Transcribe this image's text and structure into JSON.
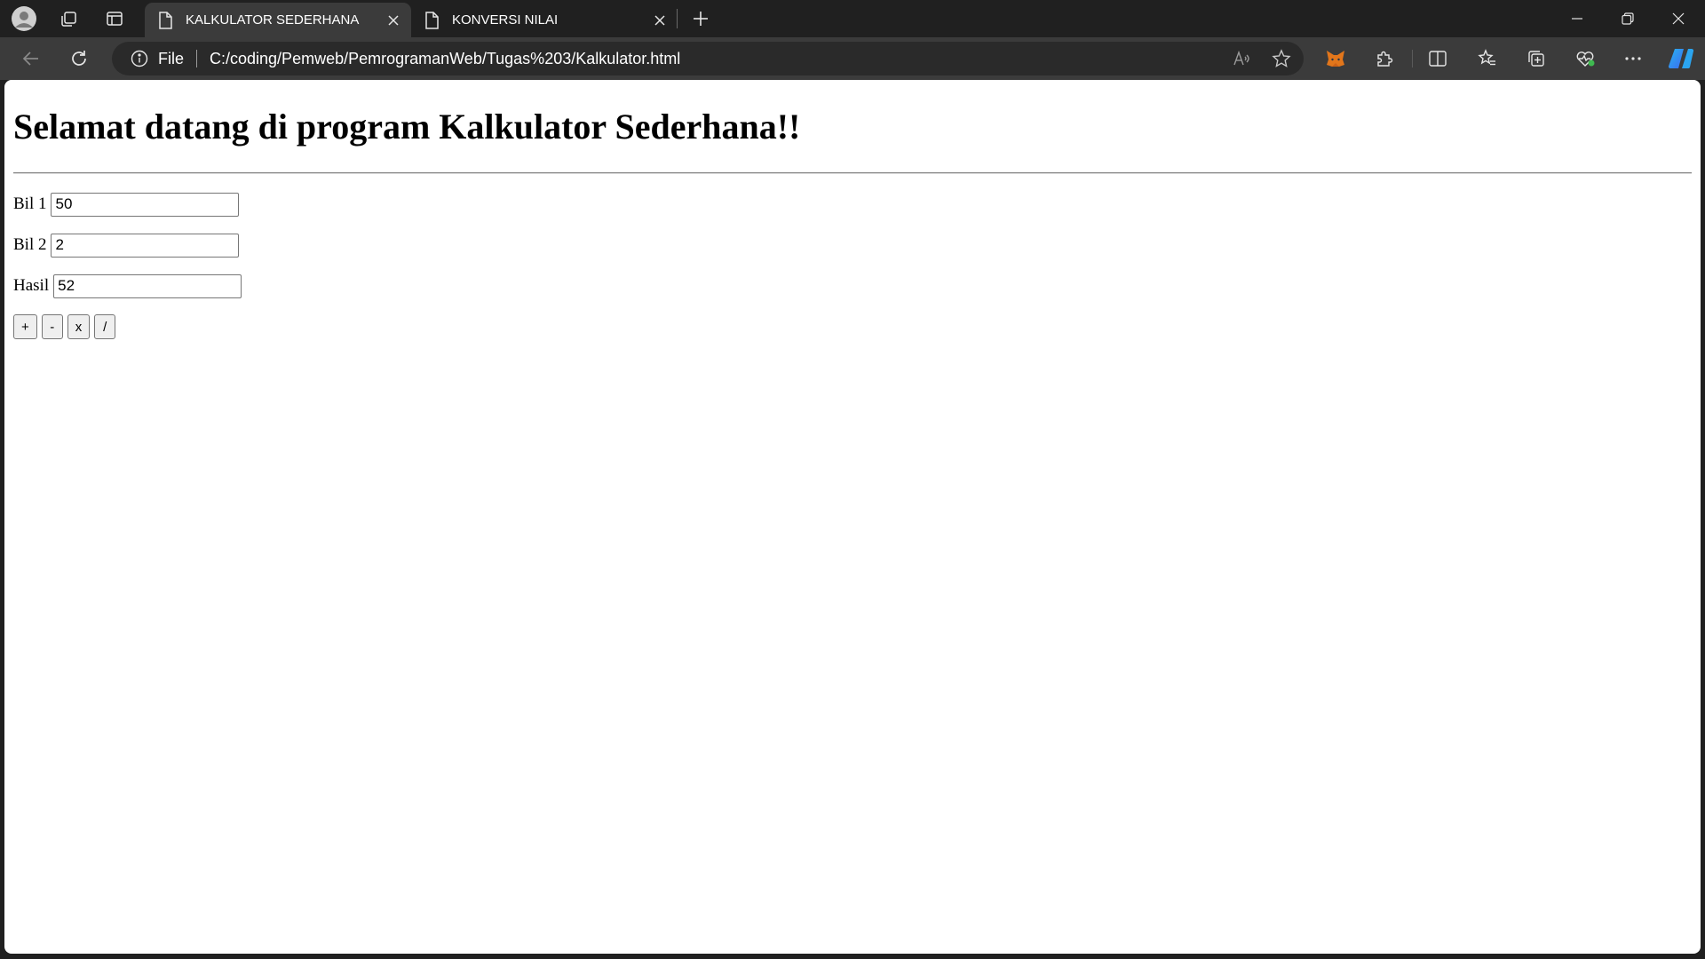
{
  "browser": {
    "tabs": [
      {
        "title": "KALKULATOR SEDERHANA",
        "active": true
      },
      {
        "title": "KONVERSI NILAI",
        "active": false
      }
    ],
    "address": {
      "scheme_label": "File",
      "url": "C:/coding/Pemweb/PemrogramanWeb/Tugas%203/Kalkulator.html"
    }
  },
  "page": {
    "heading": "Selamat datang di program Kalkulator Sederhana!!",
    "fields": {
      "bil1": {
        "label": "Bil 1",
        "value": "50"
      },
      "bil2": {
        "label": "Bil 2",
        "value": "2"
      },
      "hasil": {
        "label": "Hasil",
        "value": "52"
      }
    },
    "buttons": {
      "add": "+",
      "subtract": "-",
      "multiply": "x",
      "divide": "/"
    }
  },
  "colors": {
    "chrome_dark": "#202020",
    "chrome_toolbar": "#3b3b3b",
    "page_bg": "#ffffff"
  }
}
